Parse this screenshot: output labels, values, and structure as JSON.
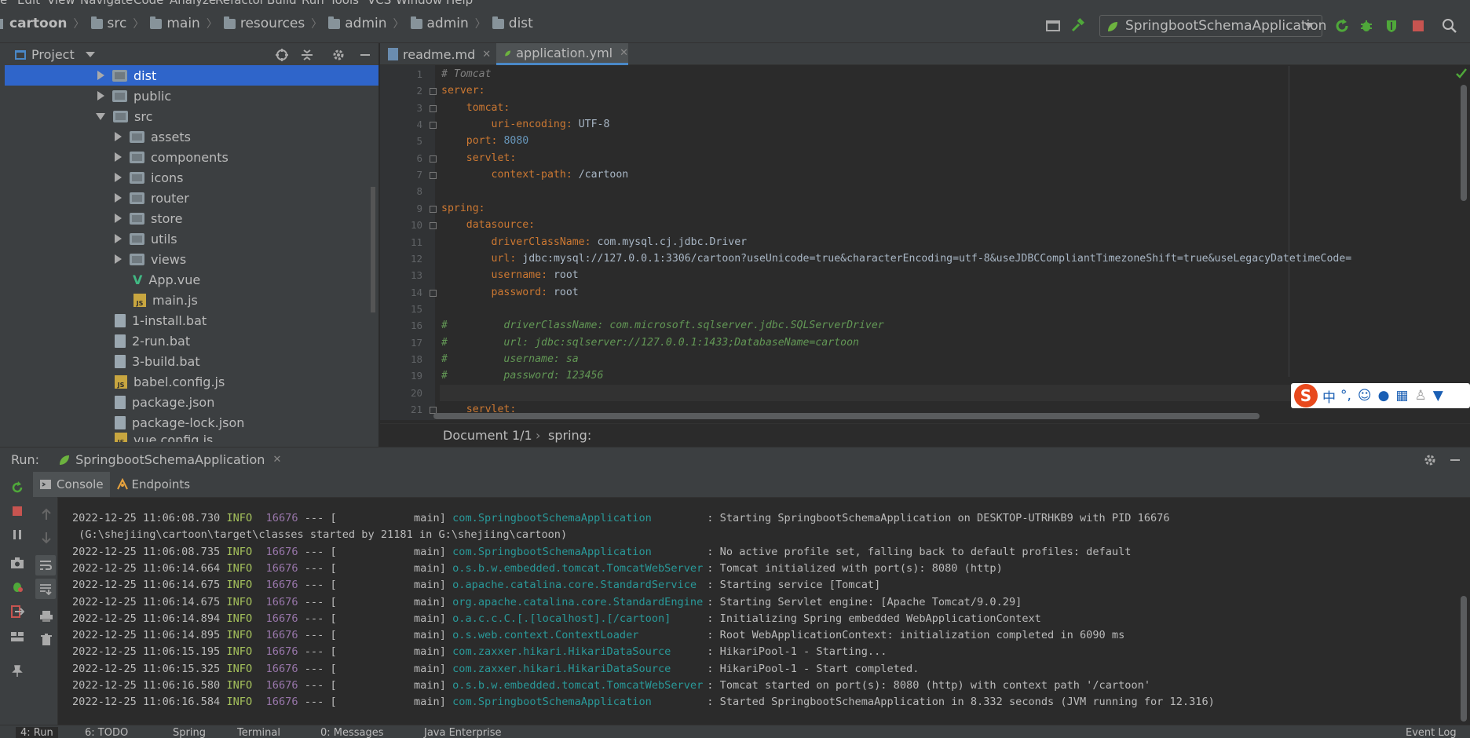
{
  "menu": [
    "e",
    "Edit",
    "View",
    "Navigate",
    "Code",
    "Analyze",
    "Refactor",
    "Build",
    "Run",
    "Tools",
    "VCS",
    "Window",
    "Help"
  ],
  "breadcrumbs": [
    "cartoon",
    "src",
    "main",
    "resources",
    "admin",
    "admin",
    "dist"
  ],
  "toolbar": {
    "run_config": "SpringbootSchemaApplication"
  },
  "project": {
    "title": "Project",
    "tree": [
      {
        "label": "dist",
        "type": "folder",
        "state": "collapsed",
        "selected": true
      },
      {
        "label": "public",
        "type": "folder",
        "state": "collapsed"
      },
      {
        "label": "src",
        "type": "folder",
        "state": "expanded"
      },
      {
        "label": "assets",
        "type": "folder",
        "state": "collapsed"
      },
      {
        "label": "components",
        "type": "folder",
        "state": "collapsed"
      },
      {
        "label": "icons",
        "type": "folder",
        "state": "collapsed"
      },
      {
        "label": "router",
        "type": "folder",
        "state": "collapsed"
      },
      {
        "label": "store",
        "type": "folder",
        "state": "collapsed"
      },
      {
        "label": "utils",
        "type": "folder",
        "state": "collapsed"
      },
      {
        "label": "views",
        "type": "folder",
        "state": "collapsed"
      },
      {
        "label": "App.vue",
        "type": "vue"
      },
      {
        "label": "main.js",
        "type": "js"
      },
      {
        "label": "1-install.bat",
        "type": "file"
      },
      {
        "label": "2-run.bat",
        "type": "file"
      },
      {
        "label": "3-build.bat",
        "type": "file"
      },
      {
        "label": "babel.config.js",
        "type": "js"
      },
      {
        "label": "package.json",
        "type": "file"
      },
      {
        "label": "package-lock.json",
        "type": "file"
      },
      {
        "label": "vue.config.js",
        "type": "js"
      }
    ]
  },
  "editor": {
    "tabs": [
      {
        "label": "readme.md",
        "active": false
      },
      {
        "label": "application.yml",
        "active": true
      }
    ],
    "lines": [
      {
        "num": "1",
        "text": "# Tomcat"
      },
      {
        "num": "2",
        "key": "server"
      },
      {
        "num": "3",
        "key": "tomcat"
      },
      {
        "num": "4",
        "key": "uri-encoding",
        "value": "UTF-8"
      },
      {
        "num": "5",
        "key": "port",
        "value": "8080"
      },
      {
        "num": "6",
        "key": "servlet"
      },
      {
        "num": "7",
        "key": "context-path",
        "value": "/cartoon"
      },
      {
        "num": "8"
      },
      {
        "num": "9",
        "key": "spring"
      },
      {
        "num": "10",
        "key": "datasource"
      },
      {
        "num": "11",
        "key": "driverClassName",
        "value": "com.mysql.cj.jdbc.Driver"
      },
      {
        "num": "12",
        "key": "url",
        "value": "jdbc:mysql://127.0.0.1:3306/cartoon?useUnicode=true&characterEncoding=utf-8&useJDBCCompliantTimezoneShift=true&useLegacyDatetimeCode="
      },
      {
        "num": "13",
        "key": "username",
        "value": "root"
      },
      {
        "num": "14",
        "key": "password",
        "value": "root"
      },
      {
        "num": "15"
      },
      {
        "num": "16",
        "text": "#         driverClassName: com.microsoft.sqlserver.jdbc.SQLServerDriver"
      },
      {
        "num": "17",
        "text": "#         url: jdbc:sqlserver://127.0.0.1:1433;DatabaseName=cartoon"
      },
      {
        "num": "18",
        "text": "#         username: sa"
      },
      {
        "num": "19",
        "text": "#         password: 123456"
      },
      {
        "num": "20"
      },
      {
        "num": "21",
        "key": "servlet"
      }
    ],
    "footer": {
      "doc": "Document 1/1",
      "path": "spring:"
    }
  },
  "ime": {
    "label": "中"
  },
  "run": {
    "label": "Run:",
    "config": "SpringbootSchemaApplication",
    "tabs": [
      "Console",
      "Endpoints"
    ],
    "log": [
      {
        "ts": "2022-12-25 11:06:08.730",
        "level": "INFO",
        "pid": "16676",
        "sep": "--- [",
        "thread": "main]",
        "logger": "com.SpringbootSchemaApplication",
        "msg": ": Starting SpringbootSchemaApplication on DESKTOP-UTRHKB9 with PID 16676"
      },
      {
        "cont": " (G:\\shejiing\\cartoon\\target\\classes started by 21181 in G:\\shejiing\\cartoon)"
      },
      {
        "ts": "2022-12-25 11:06:08.735",
        "level": "INFO",
        "pid": "16676",
        "sep": "--- [",
        "thread": "main]",
        "logger": "com.SpringbootSchemaApplication",
        "msg": ": No active profile set, falling back to default profiles: default"
      },
      {
        "ts": "2022-12-25 11:06:14.664",
        "level": "INFO",
        "pid": "16676",
        "sep": "--- [",
        "thread": "main]",
        "logger": "o.s.b.w.embedded.tomcat.TomcatWebServer",
        "msg": ": Tomcat initialized with port(s): 8080 (http)"
      },
      {
        "ts": "2022-12-25 11:06:14.675",
        "level": "INFO",
        "pid": "16676",
        "sep": "--- [",
        "thread": "main]",
        "logger": "o.apache.catalina.core.StandardService",
        "msg": ": Starting service [Tomcat]"
      },
      {
        "ts": "2022-12-25 11:06:14.675",
        "level": "INFO",
        "pid": "16676",
        "sep": "--- [",
        "thread": "main]",
        "logger": "org.apache.catalina.core.StandardEngine",
        "msg": ": Starting Servlet engine: [Apache Tomcat/9.0.29]"
      },
      {
        "ts": "2022-12-25 11:06:14.894",
        "level": "INFO",
        "pid": "16676",
        "sep": "--- [",
        "thread": "main]",
        "logger": "o.a.c.c.C.[.[localhost].[/cartoon]",
        "msg": ": Initializing Spring embedded WebApplicationContext"
      },
      {
        "ts": "2022-12-25 11:06:14.895",
        "level": "INFO",
        "pid": "16676",
        "sep": "--- [",
        "thread": "main]",
        "logger": "o.s.web.context.ContextLoader",
        "msg": ": Root WebApplicationContext: initialization completed in 6090 ms"
      },
      {
        "ts": "2022-12-25 11:06:15.195",
        "level": "INFO",
        "pid": "16676",
        "sep": "--- [",
        "thread": "main]",
        "logger": "com.zaxxer.hikari.HikariDataSource",
        "msg": ": HikariPool-1 - Starting..."
      },
      {
        "ts": "2022-12-25 11:06:15.325",
        "level": "INFO",
        "pid": "16676",
        "sep": "--- [",
        "thread": "main]",
        "logger": "com.zaxxer.hikari.HikariDataSource",
        "msg": ": HikariPool-1 - Start completed."
      },
      {
        "ts": "2022-12-25 11:06:16.580",
        "level": "INFO",
        "pid": "16676",
        "sep": "--- [",
        "thread": "main]",
        "logger": "o.s.b.w.embedded.tomcat.TomcatWebServer",
        "msg": ": Tomcat started on port(s): 8080 (http) with context path '/cartoon'"
      },
      {
        "ts": "2022-12-25 11:06:16.584",
        "level": "INFO",
        "pid": "16676",
        "sep": "--- [",
        "thread": "main]",
        "logger": "com.SpringbootSchemaApplication",
        "msg": ": Started SpringbootSchemaApplication in 8.332 seconds (JVM running for 12.316)"
      }
    ]
  },
  "statusbar": [
    "4: Run",
    "6: TODO",
    "Spring",
    "Terminal",
    "0: Messages",
    "Java Enterprise",
    "Event Log"
  ],
  "colors": {
    "selection": "#2f65ca",
    "keyword": "#cc7832",
    "number": "#6897bb",
    "comment": "#629755",
    "info": "#a5c25c",
    "logger": "#299999"
  }
}
